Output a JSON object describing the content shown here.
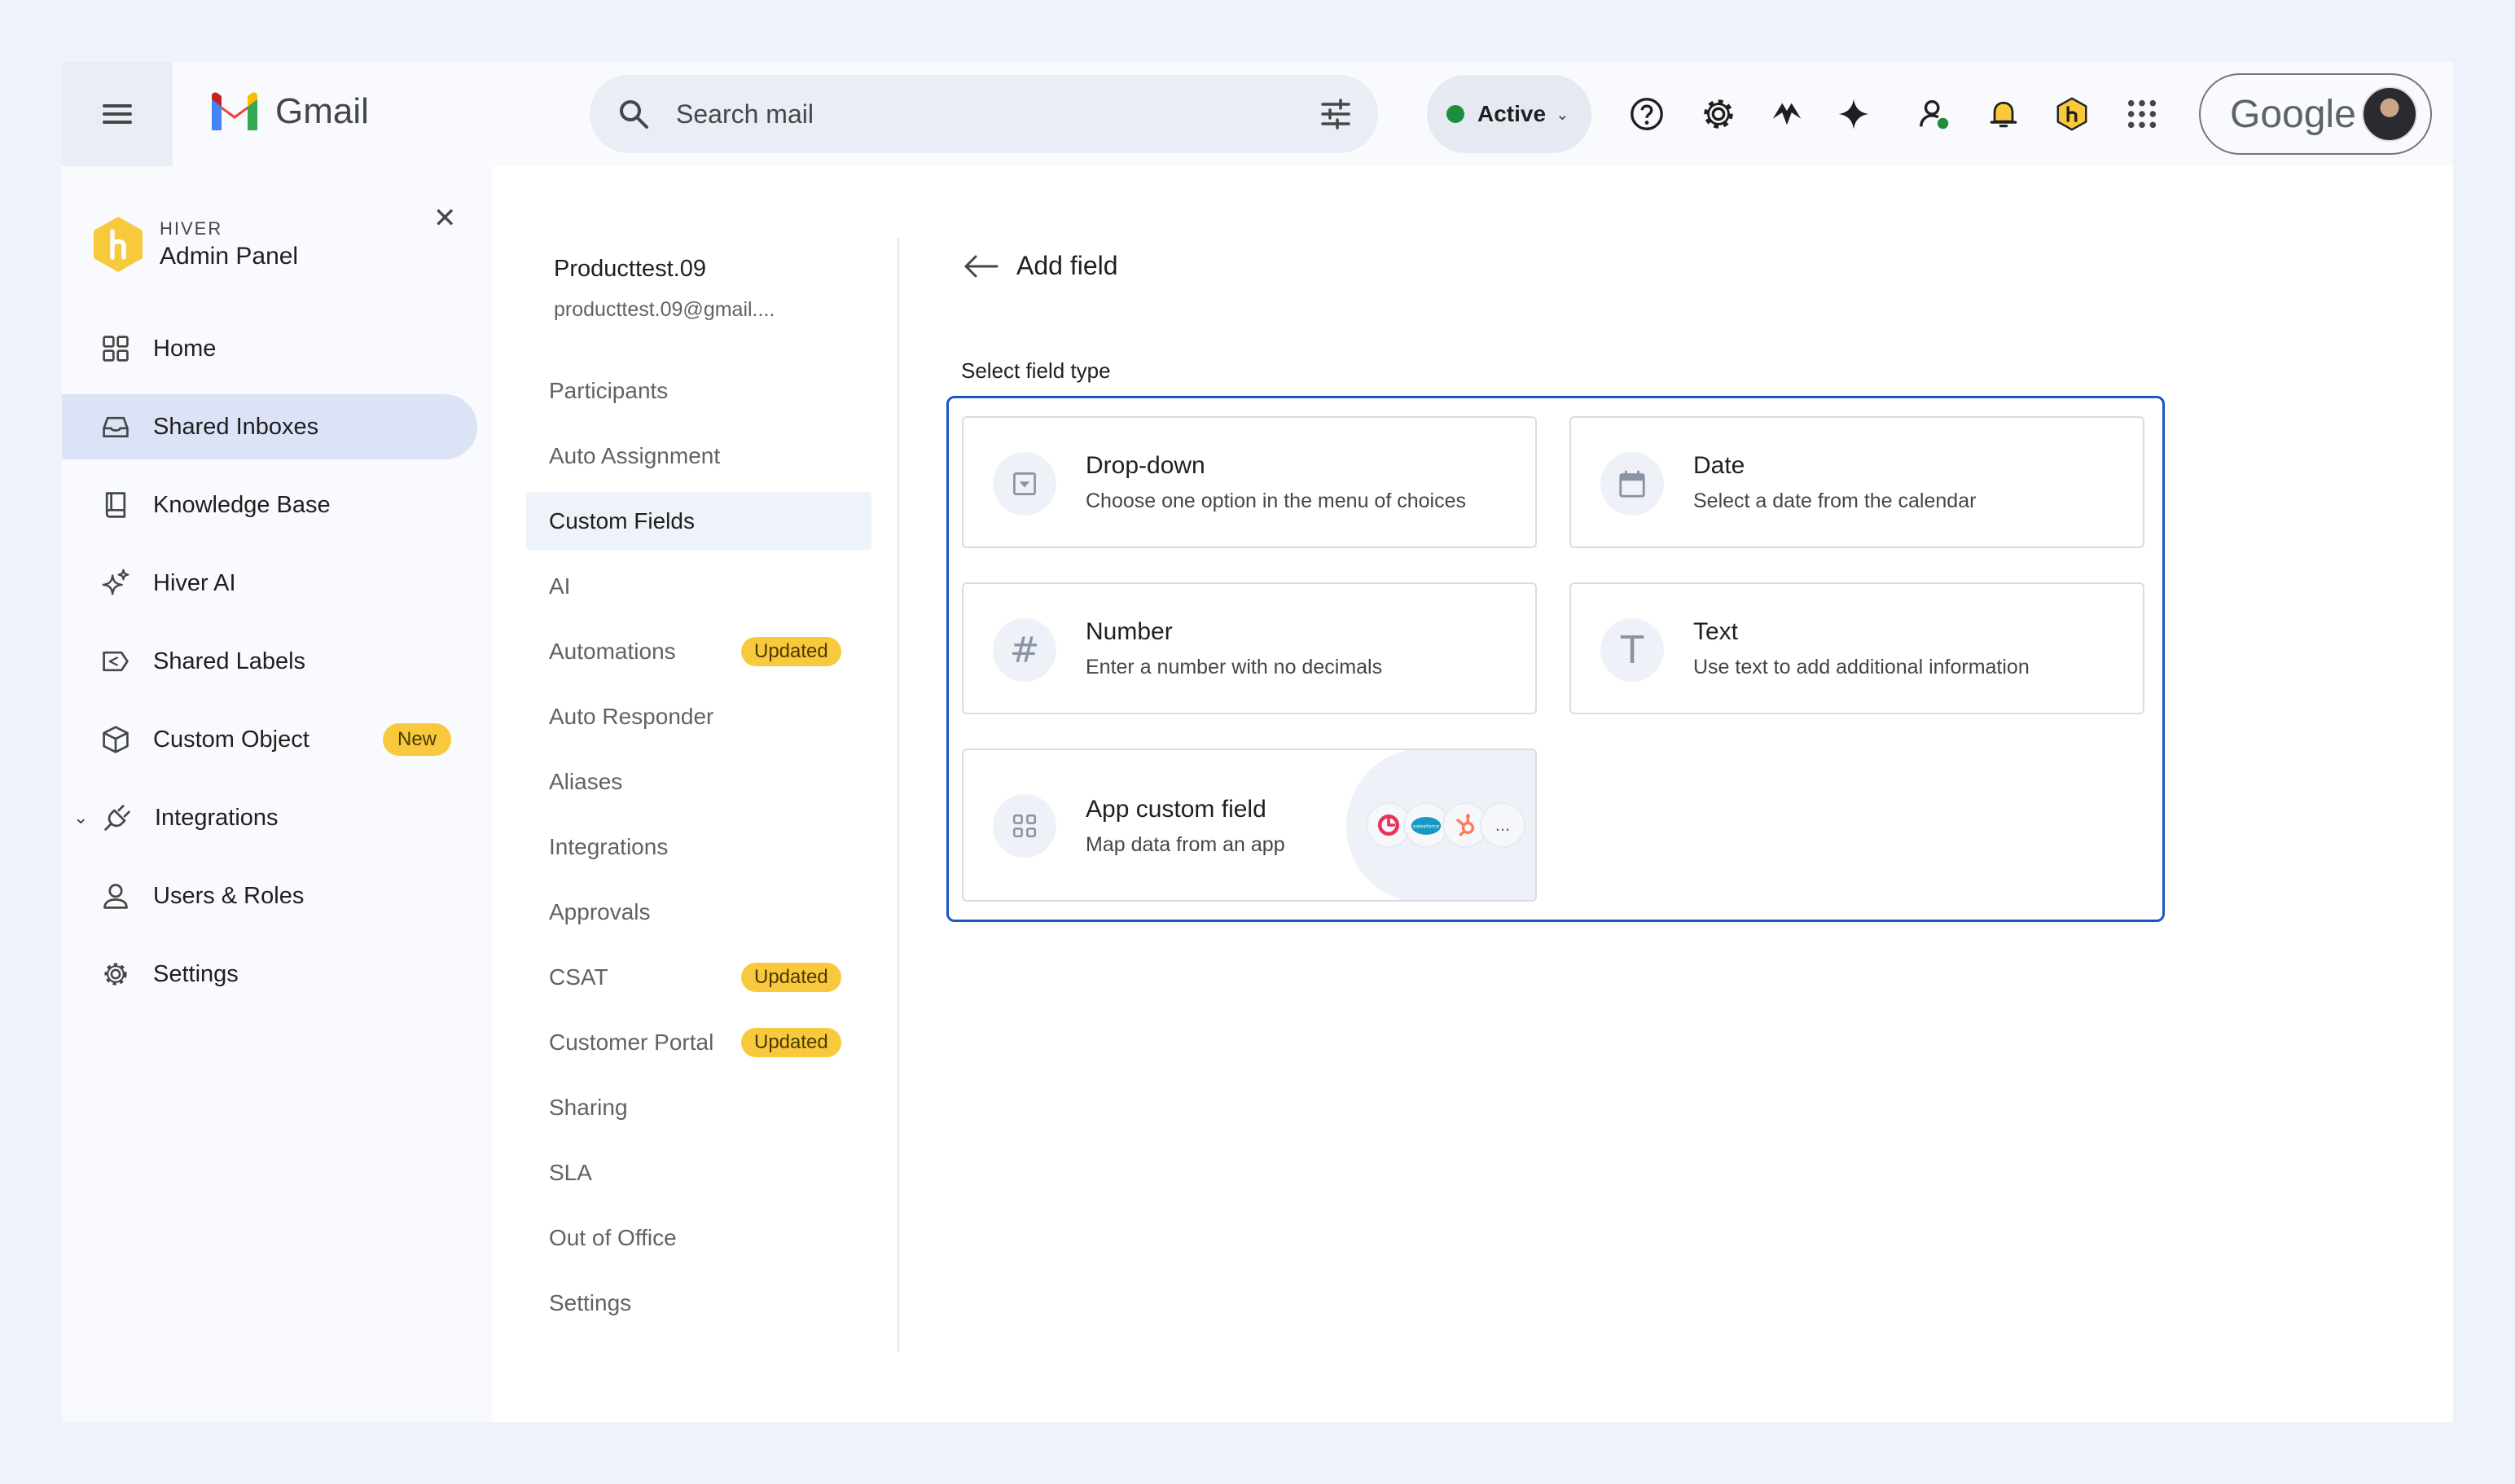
{
  "topbar": {
    "app_name": "Gmail",
    "search_placeholder": "Search mail",
    "status_label": "Active",
    "icons": [
      "help-icon",
      "settings-icon",
      "hiver-apps-icon",
      "gemini-icon",
      "contacts-status-icon",
      "notifications-icon",
      "hiver-extension-icon",
      "apps-grid-icon"
    ],
    "account_brand": "Google"
  },
  "sidebar": {
    "brand": "HIVER",
    "title": "Admin Panel",
    "items": [
      {
        "label": "Home",
        "icon": "home-grid-icon"
      },
      {
        "label": "Shared Inboxes",
        "icon": "inbox-icon",
        "active": true
      },
      {
        "label": "Knowledge Base",
        "icon": "book-icon"
      },
      {
        "label": "Hiver AI",
        "icon": "sparkle-icon"
      },
      {
        "label": "Shared Labels",
        "icon": "label-icon"
      },
      {
        "label": "Custom Object",
        "icon": "cube-icon",
        "badge": "New"
      },
      {
        "label": "Integrations",
        "icon": "plug-icon",
        "expandable": true
      },
      {
        "label": "Users & Roles",
        "icon": "user-icon"
      },
      {
        "label": "Settings",
        "icon": "gear-icon"
      }
    ]
  },
  "inbox": {
    "name": "Producttest.09",
    "email": "producttest.09@gmail....",
    "items": [
      {
        "label": "Participants"
      },
      {
        "label": "Auto Assignment"
      },
      {
        "label": "Custom Fields",
        "active": true
      },
      {
        "label": "AI"
      },
      {
        "label": "Automations",
        "badge": "Updated"
      },
      {
        "label": "Auto Responder"
      },
      {
        "label": "Aliases"
      },
      {
        "label": "Integrations"
      },
      {
        "label": "Approvals"
      },
      {
        "label": "CSAT",
        "badge": "Updated"
      },
      {
        "label": "Customer Portal",
        "badge": "Updated"
      },
      {
        "label": "Sharing"
      },
      {
        "label": "SLA"
      },
      {
        "label": "Out of Office"
      },
      {
        "label": "Settings"
      }
    ]
  },
  "add_field": {
    "title": "Add field",
    "select_label": "Select field type",
    "types": [
      {
        "title": "Drop-down",
        "desc": "Choose one option in the menu of choices",
        "icon": "dropdown-icon"
      },
      {
        "title": "Date",
        "desc": "Select a date from the calendar",
        "icon": "calendar-icon"
      },
      {
        "title": "Number",
        "desc": "Enter a number with no decimals",
        "icon": "hash-icon",
        "glyph": "#"
      },
      {
        "title": "Text",
        "desc": "Use text to add additional information",
        "icon": "text-icon",
        "glyph": "T"
      },
      {
        "title": "App custom field",
        "desc": "Map data from an app",
        "icon": "apps-icon"
      }
    ],
    "app_logos": [
      "clockify-icon",
      "salesforce-icon",
      "hubspot-icon",
      "more-icon"
    ],
    "salesforce_text": "salesforce",
    "more_text": "..."
  },
  "colors": {
    "accent_blue": "#1a56c6",
    "badge_yellow": "#f8c93c",
    "status_green": "#1e8e3e",
    "active_nav": "#dde3f7"
  }
}
